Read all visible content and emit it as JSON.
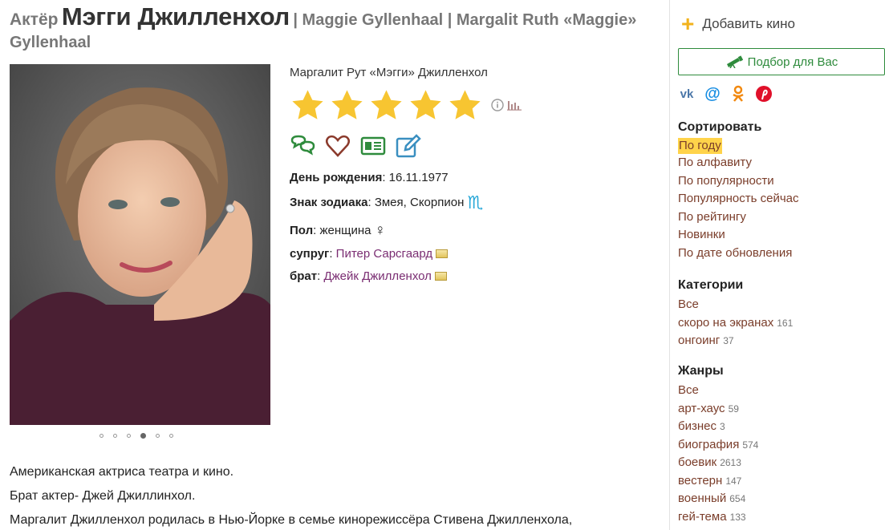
{
  "header": {
    "kind": "Актёр",
    "name": "Мэгги Джилленхол",
    "alt_names": "| Maggie Gyllenhaal | Margalit Ruth «Maggie» Gyllenhaal"
  },
  "person": {
    "full_name": "Маргалит Рут «Мэгги» Джилленхол",
    "rating_stars": 5,
    "birthday_label": "День рождения",
    "birthday_value": "16.11.1977",
    "zodiac_label": "Знак зодиака",
    "zodiac_value": "Змея, Скорпион",
    "zodiac_symbol": "♏",
    "gender_label": "Пол",
    "gender_value": "женщина",
    "gender_symbol": "♀",
    "spouse_label": "супруг",
    "spouse_value": "Питер Сарсгаард",
    "brother_label": "брат",
    "brother_value": "Джейк Джилленхол"
  },
  "gallery": {
    "count": 6,
    "active_index": 3
  },
  "bio": [
    "Американская актриса театра и кино.",
    "Брат актер- Джей Джиллинхол.",
    "Маргалит Джилленхол родилась в Нью-Йорке в семье кинорежиссёра Стивена Джилленхола,"
  ],
  "sidebar": {
    "add_label": "Добавить кино",
    "pick_label": "Подбор для Вас",
    "sort_title": "Сортировать",
    "sort_items": [
      {
        "label": "По году",
        "active": true
      },
      {
        "label": "По алфавиту"
      },
      {
        "label": "По популярности"
      },
      {
        "label": "Популярность сейчас"
      },
      {
        "label": "По рейтингу"
      },
      {
        "label": "Новинки"
      },
      {
        "label": "По дате обновления"
      }
    ],
    "categories_title": "Категории",
    "categories": [
      {
        "label": "Все",
        "count": ""
      },
      {
        "label": "скоро на экранах",
        "count": "161"
      },
      {
        "label": "онгоинг",
        "count": "37"
      }
    ],
    "genres_title": "Жанры",
    "genres": [
      {
        "label": "Все",
        "count": ""
      },
      {
        "label": "арт-хаус",
        "count": "59"
      },
      {
        "label": "бизнес",
        "count": "3"
      },
      {
        "label": "биография",
        "count": "574"
      },
      {
        "label": "боевик",
        "count": "2613"
      },
      {
        "label": "вестерн",
        "count": "147"
      },
      {
        "label": "военный",
        "count": "654"
      },
      {
        "label": "гей-тема",
        "count": "133"
      }
    ]
  },
  "colors": {
    "accent_green": "#2e8b3c",
    "link_purple": "#7a2d72",
    "star": "#f7c531",
    "highlight": "#ffd34a"
  }
}
